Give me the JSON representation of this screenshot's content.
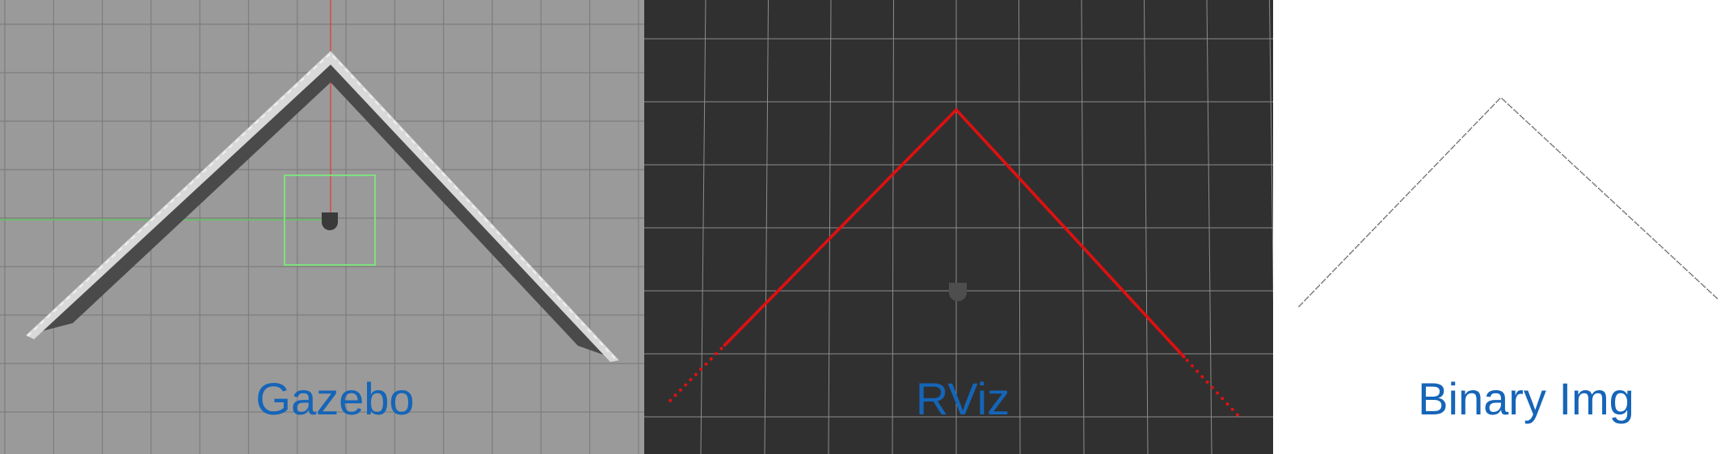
{
  "panels": {
    "gazebo": {
      "label": "Gazebo",
      "background": "#9a9a9a",
      "grid_color": "#7d7d7d",
      "wall_top_color": "#d9d9d9",
      "wall_side_color": "#4a4a4a",
      "x_axis_color": "#d84a4a",
      "y_axis_color": "#63c463",
      "selection_box_color": "#7fe07f",
      "robot_color": "#3a3a3a",
      "robot_icon": "robot-base-icon"
    },
    "rviz": {
      "label": "RViz",
      "background": "#303030",
      "grid_color": "#8c8c8c",
      "scan_color": "#e01010",
      "robot_color": "#4e4e4e",
      "robot_icon": "robot-base-icon"
    },
    "binary": {
      "label": "Binary Img",
      "background": "#ffffff",
      "pixel_color": "#555555"
    }
  },
  "label_color": "#1565b8"
}
